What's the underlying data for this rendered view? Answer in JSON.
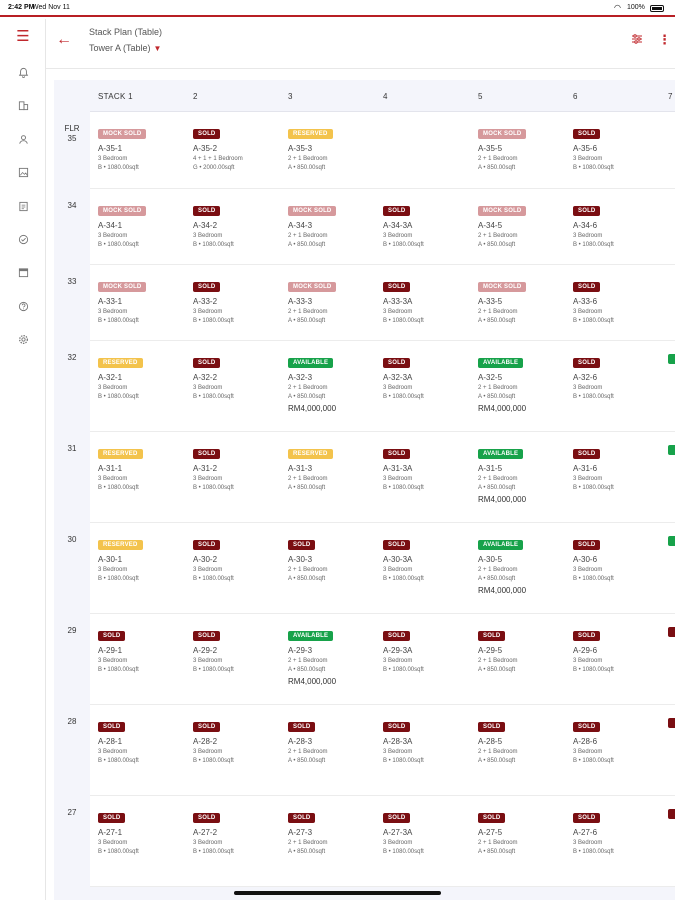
{
  "status": {
    "time": "2:42 PM",
    "date": "Wed Nov 11",
    "battery": "100%"
  },
  "header": {
    "title": "Stack Plan (Table)",
    "subtitle": "Tower A (Table)"
  },
  "columns": [
    "STACK 1",
    "2",
    "3",
    "4",
    "5",
    "6",
    "7"
  ],
  "floors": [
    {
      "label": "FLR\n35",
      "units": [
        {
          "status": "MOCK SOLD",
          "kind": "mock",
          "id": "A-35-1",
          "type": "3 Bedroom",
          "size": "B  •  1080.00sqft"
        },
        {
          "status": "SOLD",
          "kind": "sold",
          "id": "A-35-2",
          "type": "4 + 1 + 1 Bedroom",
          "size": "G  •  2000.00sqft"
        },
        {
          "status": "RESERVED",
          "kind": "reserved",
          "id": "A-35-3",
          "type": "2 + 1 Bedroom",
          "size": "A  •  850.00sqft"
        },
        null,
        {
          "status": "MOCK SOLD",
          "kind": "mock",
          "id": "A-35-5",
          "type": "2 + 1 Bedroom",
          "size": "A  •  850.00sqft"
        },
        {
          "status": "SOLD",
          "kind": "sold",
          "id": "A-35-6",
          "type": "3 Bedroom",
          "size": "B  •  1080.00sqft"
        }
      ]
    },
    {
      "label": "34",
      "units": [
        {
          "status": "MOCK SOLD",
          "kind": "mock",
          "id": "A-34-1",
          "type": "3 Bedroom",
          "size": "B  •  1080.00sqft"
        },
        {
          "status": "SOLD",
          "kind": "sold",
          "id": "A-34-2",
          "type": "3 Bedroom",
          "size": "B  •  1080.00sqft"
        },
        {
          "status": "MOCK SOLD",
          "kind": "mock",
          "id": "A-34-3",
          "type": "2 + 1 Bedroom",
          "size": "A  •  850.00sqft"
        },
        {
          "status": "SOLD",
          "kind": "sold",
          "id": "A-34-3A",
          "type": "3 Bedroom",
          "size": "B  •  1080.00sqft"
        },
        {
          "status": "MOCK SOLD",
          "kind": "mock",
          "id": "A-34-5",
          "type": "2 + 1 Bedroom",
          "size": "A  •  850.00sqft"
        },
        {
          "status": "SOLD",
          "kind": "sold",
          "id": "A-34-6",
          "type": "3 Bedroom",
          "size": "B  •  1080.00sqft"
        }
      ]
    },
    {
      "label": "33",
      "units": [
        {
          "status": "MOCK SOLD",
          "kind": "mock",
          "id": "A-33-1",
          "type": "3 Bedroom",
          "size": "B  •  1080.00sqft"
        },
        {
          "status": "SOLD",
          "kind": "sold",
          "id": "A-33-2",
          "type": "3 Bedroom",
          "size": "B  •  1080.00sqft"
        },
        {
          "status": "MOCK SOLD",
          "kind": "mock",
          "id": "A-33-3",
          "type": "2 + 1 Bedroom",
          "size": "A  •  850.00sqft"
        },
        {
          "status": "SOLD",
          "kind": "sold",
          "id": "A-33-3A",
          "type": "3 Bedroom",
          "size": "B  •  1080.00sqft"
        },
        {
          "status": "MOCK SOLD",
          "kind": "mock",
          "id": "A-33-5",
          "type": "2 + 1 Bedroom",
          "size": "A  •  850.00sqft"
        },
        {
          "status": "SOLD",
          "kind": "sold",
          "id": "A-33-6",
          "type": "3 Bedroom",
          "size": "B  •  1080.00sqft"
        }
      ]
    },
    {
      "label": "32",
      "units": [
        {
          "status": "RESERVED",
          "kind": "reserved",
          "id": "A-32-1",
          "type": "3 Bedroom",
          "size": "B  •  1080.00sqft"
        },
        {
          "status": "SOLD",
          "kind": "sold",
          "id": "A-32-2",
          "type": "3 Bedroom",
          "size": "B  •  1080.00sqft"
        },
        {
          "status": "AVAILABLE",
          "kind": "available",
          "id": "A-32-3",
          "type": "2 + 1 Bedroom",
          "size": "A  •  850.00sqft",
          "price": "RM4,000,000"
        },
        {
          "status": "SOLD",
          "kind": "sold",
          "id": "A-32-3A",
          "type": "3 Bedroom",
          "size": "B  •  1080.00sqft"
        },
        {
          "status": "AVAILABLE",
          "kind": "available",
          "id": "A-32-5",
          "type": "2 + 1 Bedroom",
          "size": "A  •  850.00sqft",
          "price": "RM4,000,000"
        },
        {
          "status": "SOLD",
          "kind": "sold",
          "id": "A-32-6",
          "type": "3 Bedroom",
          "size": "B  •  1080.00sqft"
        }
      ]
    },
    {
      "label": "31",
      "units": [
        {
          "status": "RESERVED",
          "kind": "reserved",
          "id": "A-31-1",
          "type": "3 Bedroom",
          "size": "B  •  1080.00sqft"
        },
        {
          "status": "SOLD",
          "kind": "sold",
          "id": "A-31-2",
          "type": "3 Bedroom",
          "size": "B  •  1080.00sqft"
        },
        {
          "status": "RESERVED",
          "kind": "reserved",
          "id": "A-31-3",
          "type": "2 + 1 Bedroom",
          "size": "A  •  850.00sqft"
        },
        {
          "status": "SOLD",
          "kind": "sold",
          "id": "A-31-3A",
          "type": "3 Bedroom",
          "size": "B  •  1080.00sqft"
        },
        {
          "status": "AVAILABLE",
          "kind": "available",
          "id": "A-31-5",
          "type": "2 + 1 Bedroom",
          "size": "A  •  850.00sqft",
          "price": "RM4,000,000"
        },
        {
          "status": "SOLD",
          "kind": "sold",
          "id": "A-31-6",
          "type": "3 Bedroom",
          "size": "B  •  1080.00sqft"
        }
      ]
    },
    {
      "label": "30",
      "units": [
        {
          "status": "RESERVED",
          "kind": "reserved",
          "id": "A-30-1",
          "type": "3 Bedroom",
          "size": "B  •  1080.00sqft"
        },
        {
          "status": "SOLD",
          "kind": "sold",
          "id": "A-30-2",
          "type": "3 Bedroom",
          "size": "B  •  1080.00sqft"
        },
        {
          "status": "SOLD",
          "kind": "sold",
          "id": "A-30-3",
          "type": "2 + 1 Bedroom",
          "size": "A  •  850.00sqft"
        },
        {
          "status": "SOLD",
          "kind": "sold",
          "id": "A-30-3A",
          "type": "3 Bedroom",
          "size": "B  •  1080.00sqft"
        },
        {
          "status": "AVAILABLE",
          "kind": "available",
          "id": "A-30-5",
          "type": "2 + 1 Bedroom",
          "size": "A  •  850.00sqft",
          "price": "RM4,000,000"
        },
        {
          "status": "SOLD",
          "kind": "sold",
          "id": "A-30-6",
          "type": "3 Bedroom",
          "size": "B  •  1080.00sqft"
        }
      ]
    },
    {
      "label": "29",
      "units": [
        {
          "status": "SOLD",
          "kind": "sold",
          "id": "A-29-1",
          "type": "3 Bedroom",
          "size": "B  •  1080.00sqft"
        },
        {
          "status": "SOLD",
          "kind": "sold",
          "id": "A-29-2",
          "type": "3 Bedroom",
          "size": "B  •  1080.00sqft"
        },
        {
          "status": "AVAILABLE",
          "kind": "available",
          "id": "A-29-3",
          "type": "2 + 1 Bedroom",
          "size": "A  •  850.00sqft",
          "price": "RM4,000,000"
        },
        {
          "status": "SOLD",
          "kind": "sold",
          "id": "A-29-3A",
          "type": "3 Bedroom",
          "size": "B  •  1080.00sqft"
        },
        {
          "status": "SOLD",
          "kind": "sold",
          "id": "A-29-5",
          "type": "2 + 1 Bedroom",
          "size": "A  •  850.00sqft"
        },
        {
          "status": "SOLD",
          "kind": "sold",
          "id": "A-29-6",
          "type": "3 Bedroom",
          "size": "B  •  1080.00sqft"
        }
      ]
    },
    {
      "label": "28",
      "units": [
        {
          "status": "SOLD",
          "kind": "sold",
          "id": "A-28-1",
          "type": "3 Bedroom",
          "size": "B  •  1080.00sqft"
        },
        {
          "status": "SOLD",
          "kind": "sold",
          "id": "A-28-2",
          "type": "3 Bedroom",
          "size": "B  •  1080.00sqft"
        },
        {
          "status": "SOLD",
          "kind": "sold",
          "id": "A-28-3",
          "type": "2 + 1 Bedroom",
          "size": "A  •  850.00sqft"
        },
        {
          "status": "SOLD",
          "kind": "sold",
          "id": "A-28-3A",
          "type": "3 Bedroom",
          "size": "B  •  1080.00sqft"
        },
        {
          "status": "SOLD",
          "kind": "sold",
          "id": "A-28-5",
          "type": "2 + 1 Bedroom",
          "size": "A  •  850.00sqft"
        },
        {
          "status": "SOLD",
          "kind": "sold",
          "id": "A-28-6",
          "type": "3 Bedroom",
          "size": "B  •  1080.00sqft"
        }
      ]
    },
    {
      "label": "27",
      "units": [
        {
          "status": "SOLD",
          "kind": "sold",
          "id": "A-27-1",
          "type": "3 Bedroom",
          "size": "B  •  1080.00sqft"
        },
        {
          "status": "SOLD",
          "kind": "sold",
          "id": "A-27-2",
          "type": "3 Bedroom",
          "size": "B  •  1080.00sqft"
        },
        {
          "status": "SOLD",
          "kind": "sold",
          "id": "A-27-3",
          "type": "2 + 1 Bedroom",
          "size": "A  •  850.00sqft"
        },
        {
          "status": "SOLD",
          "kind": "sold",
          "id": "A-27-3A",
          "type": "3 Bedroom",
          "size": "B  •  1080.00sqft"
        },
        {
          "status": "SOLD",
          "kind": "sold",
          "id": "A-27-5",
          "type": "2 + 1 Bedroom",
          "size": "A  •  850.00sqft"
        },
        {
          "status": "SOLD",
          "kind": "sold",
          "id": "A-27-6",
          "type": "3 Bedroom",
          "size": "B  •  1080.00sqft"
        }
      ]
    }
  ],
  "colors": {
    "brand": "#c0282d",
    "sold": "#7a0e12",
    "mock_sold": "#d6999c",
    "reserved": "#f3c34c",
    "available": "#17a24a"
  }
}
